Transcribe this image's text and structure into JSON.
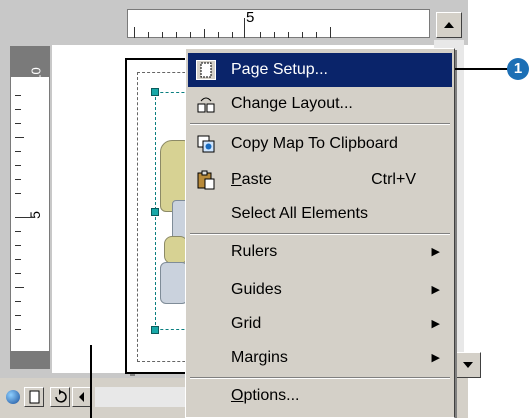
{
  "ruler": {
    "h_label": "5",
    "v_label_top": "10",
    "v_label_mid": "5"
  },
  "icons": {
    "scroll_up": "triangle-up",
    "scroll_down": "triangle-down",
    "submenu": "triangle-right"
  },
  "menu": {
    "items": [
      {
        "label": "Page Setup...",
        "icon": "page-setup-icon",
        "selected": true
      },
      {
        "label": "Change Layout...",
        "icon": "change-layout-icon"
      },
      {
        "label": "Copy Map To Clipboard",
        "icon": "copy-map-icon"
      },
      {
        "label": "Paste",
        "icon": "paste-icon",
        "shortcut": "Ctrl+V"
      },
      {
        "label": "Select All Elements"
      },
      {
        "label": "Rulers",
        "submenu": true
      },
      {
        "label": "Guides",
        "submenu": true
      },
      {
        "label": "Grid",
        "submenu": true
      },
      {
        "label": "Margins",
        "submenu": true
      },
      {
        "label": "Options..."
      }
    ]
  },
  "callout": {
    "number": "1"
  },
  "colors": {
    "highlight": "#0a246a",
    "callout": "#1c6fb5",
    "selection_handle": "#18a8a8"
  }
}
